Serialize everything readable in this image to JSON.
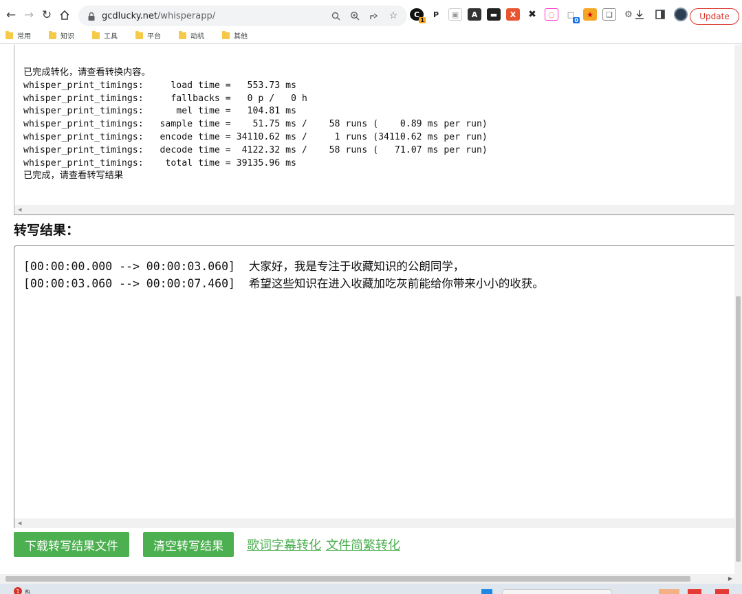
{
  "browser": {
    "url_host": "gcdlucky.net",
    "url_path": "/whisperapp/",
    "update_label": "Update",
    "extension_badges": [
      "1",
      "0"
    ]
  },
  "bookmarks": [
    {
      "label": "常用"
    },
    {
      "label": "知识"
    },
    {
      "label": "工具"
    },
    {
      "label": "平台"
    },
    {
      "label": "动机"
    },
    {
      "label": "其他"
    }
  ],
  "log": {
    "lines": [
      "已完成转化，请查看转换内容。",
      "whisper_print_timings:     load time =   553.73 ms",
      "whisper_print_timings:     fallbacks =   0 p /   0 h",
      "whisper_print_timings:      mel time =   104.81 ms",
      "whisper_print_timings:   sample time =    51.75 ms /    58 runs (    0.89 ms per run)",
      "whisper_print_timings:   encode time = 34110.62 ms /     1 runs (34110.62 ms per run)",
      "whisper_print_timings:   decode time =  4122.32 ms /    58 runs (   71.07 ms per run)",
      "whisper_print_timings:    total time = 39135.96 ms",
      "已完成，请查看转写结果"
    ]
  },
  "result": {
    "heading": "转写结果：",
    "lines": [
      "[00:00:00.000 --> 00:00:03.060]  大家好，我是专注于收藏知识的公朗同学，",
      "[00:00:03.060 --> 00:00:07.460]  希望这些知识在进入收藏加吃灰前能给你带来小小的收获。"
    ]
  },
  "actions": {
    "download_label": "下载转写结果文件",
    "clear_label": "清空转写结果",
    "lyrics_link": "歌词字幕转化",
    "convert_link": "文件简繁转化"
  },
  "taskbar": {
    "badge": "1",
    "label": "热"
  },
  "colors": {
    "accent_green": "#4caf50",
    "update_red": "#d93025"
  }
}
